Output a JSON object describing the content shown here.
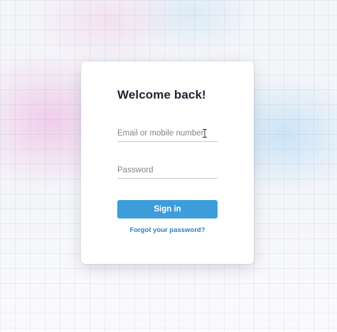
{
  "login": {
    "title": "Welcome back!",
    "email": {
      "value": "",
      "placeholder": "Email or mobile number"
    },
    "password": {
      "value": "",
      "placeholder": "Password"
    },
    "signin_label": "Sign in",
    "forgot_label": "Forgot your password?"
  },
  "icons": {
    "cursor": "text-cursor-icon"
  },
  "colors": {
    "accent": "#3d9ddb",
    "link": "#2f7fbd",
    "title_text": "#1f2430",
    "placeholder_text": "#80858e",
    "card_background": "#ffffff",
    "page_background": "#f4f5f9"
  }
}
